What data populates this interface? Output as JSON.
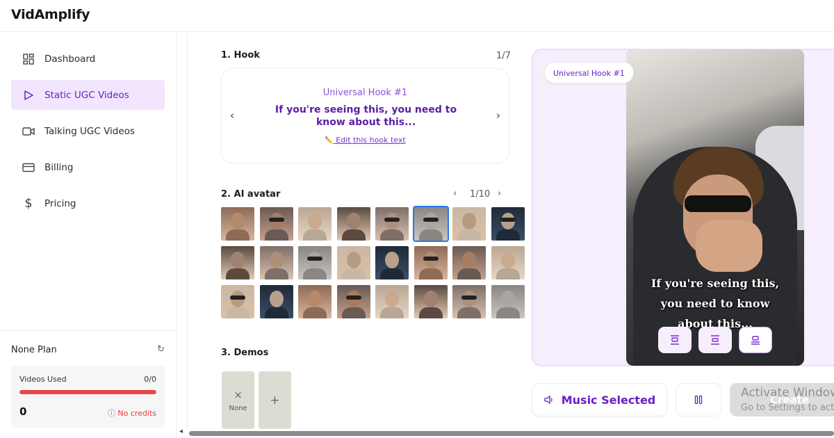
{
  "app": {
    "brand": "VidAmplify"
  },
  "sidebar": {
    "items": [
      {
        "label": "Dashboard",
        "icon": "dashboard-grid-icon",
        "active": false
      },
      {
        "label": "Static UGC Videos",
        "icon": "play-triangle-icon",
        "active": true
      },
      {
        "label": "Talking UGC Videos",
        "icon": "video-camera-icon",
        "active": false
      },
      {
        "label": "Billing",
        "icon": "credit-card-icon",
        "active": false
      },
      {
        "label": "Pricing",
        "icon": "dollar-sign-icon",
        "active": false
      }
    ],
    "plan": {
      "title": "None Plan",
      "refresh_icon": "↻",
      "videos_used_label": "Videos Used",
      "videos_used_count": "0/0",
      "usage_fraction": 1.0,
      "credits_number": "0",
      "no_credits_label": "No credits"
    }
  },
  "hook": {
    "section_title": "1. Hook",
    "counter": "1/7",
    "label": "Universal Hook #1",
    "text": "If you're seeing this, you need to know about this...",
    "edit_label": "Edit this hook text",
    "edit_icon": "✏️"
  },
  "avatar": {
    "section_title": "2. AI avatar",
    "counter": "1/10",
    "selected_index": 5,
    "count": 24
  },
  "demos": {
    "section_title": "3. Demos",
    "none_label": "None",
    "x_glyph": "×",
    "plus_glyph": "+"
  },
  "preview": {
    "hook_badge": "Universal Hook #1",
    "caption_lines": [
      "If you're seeing this,",
      "you need to know",
      "about this..."
    ]
  },
  "actions": {
    "music_label": "Music Selected",
    "create_label": "Create Video",
    "windows_watermark_title": "Activate Windows",
    "windows_watermark_sub": "Go to Settings to activate Windows."
  },
  "colors": {
    "accent": "#6a1fc4",
    "active_bg": "#f1e6fd",
    "danger": "#e94545",
    "selected_outline": "#2c78e6"
  }
}
